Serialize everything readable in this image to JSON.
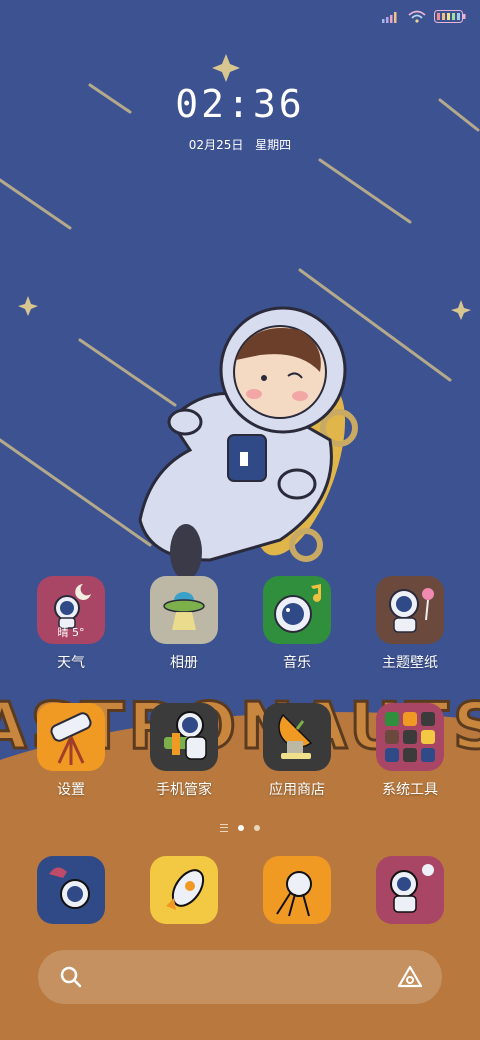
{
  "status_bar": {
    "signal_icon": "signal-bars-icon",
    "wifi_icon": "wifi-icon",
    "battery_icon": "battery-icon"
  },
  "lockclock": {
    "time": "02:36",
    "date": "02月25日",
    "weekday": "星期四"
  },
  "wallpaper": {
    "word": "ASTRONAUTS",
    "colors": {
      "sky": "#3d5291",
      "ground": "#b9793e",
      "star": "#d8c690"
    }
  },
  "row1": [
    {
      "label": "天气",
      "badge": "晴 5°",
      "color": "#a94565"
    },
    {
      "label": "相册",
      "color": "#bdb8a6"
    },
    {
      "label": "音乐",
      "color": "#2f8f3c"
    },
    {
      "label": "主题壁纸",
      "color": "#6b4a3d"
    }
  ],
  "row2": [
    {
      "label": "设置",
      "color": "#f09a24"
    },
    {
      "label": "手机管家",
      "color": "#3b3b3b"
    },
    {
      "label": "应用商店",
      "color": "#3a3a3a"
    },
    {
      "label": "系统工具",
      "color": "#a94565"
    }
  ],
  "dock": [
    {
      "name": "phone",
      "color": "#2f4a86"
    },
    {
      "name": "messages",
      "color": "#f3c843"
    },
    {
      "name": "browser",
      "color": "#f09a24"
    },
    {
      "name": "camera",
      "color": "#a94565"
    }
  ],
  "page_indicator": {
    "current": 2,
    "total": 2
  },
  "search": {
    "placeholder": ""
  }
}
